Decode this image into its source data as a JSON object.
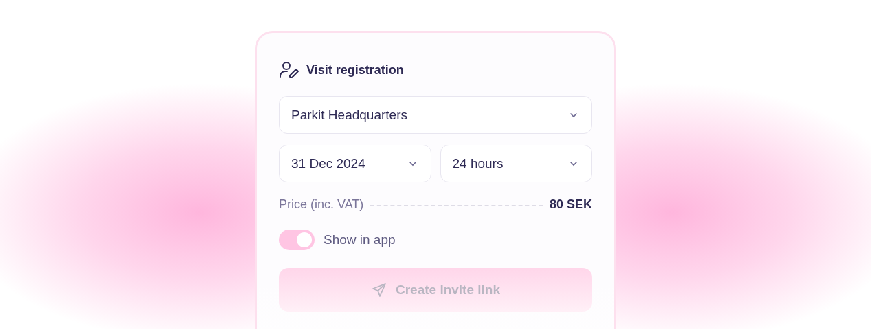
{
  "card": {
    "title": "Visit registration",
    "location": {
      "value": "Parkit Headquarters"
    },
    "date": {
      "value": "31 Dec 2024"
    },
    "duration": {
      "value": "24 hours"
    },
    "price": {
      "label": "Price (inc. VAT)",
      "value": "80 SEK"
    },
    "show_in_app": {
      "label": "Show in app",
      "on": true
    },
    "create_button": {
      "label": "Create invite link",
      "disabled": true
    }
  }
}
